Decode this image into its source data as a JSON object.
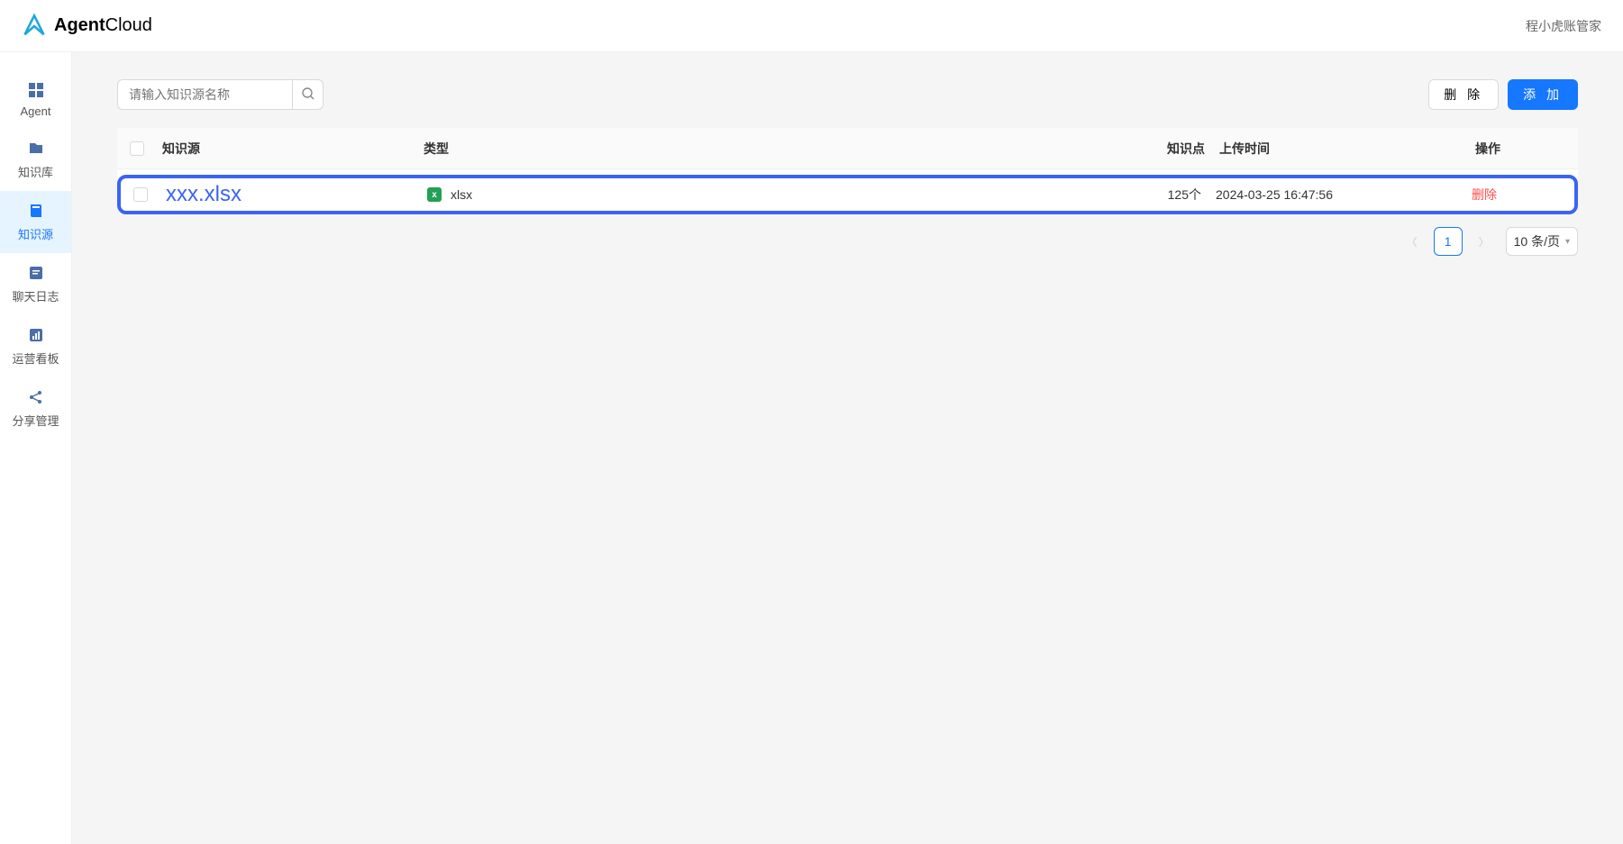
{
  "header": {
    "logo_bold": "Agent",
    "logo_light": "Cloud",
    "user_name": "程小虎账管家"
  },
  "sidebar": {
    "items": [
      {
        "label": "Agent",
        "icon": "grid-icon"
      },
      {
        "label": "知识库",
        "icon": "folder-icon"
      },
      {
        "label": "知识源",
        "icon": "book-icon",
        "active": true
      },
      {
        "label": "聊天日志",
        "icon": "chat-log-icon"
      },
      {
        "label": "运营看板",
        "icon": "dashboard-icon"
      },
      {
        "label": "分享管理",
        "icon": "share-icon"
      }
    ]
  },
  "toolbar": {
    "search_placeholder": "请输入知识源名称",
    "delete_label": "删 除",
    "add_label": "添 加"
  },
  "table": {
    "headers": {
      "name": "知识源",
      "type": "类型",
      "points": "知识点",
      "upload_time": "上传时间",
      "action": "操作"
    },
    "rows": [
      {
        "name": "xxx.xlsx",
        "type": "xlsx",
        "points": "125个",
        "upload_time": "2024-03-25 16:47:56",
        "action": "删除"
      }
    ]
  },
  "pagination": {
    "current": "1",
    "page_size_label": "10 条/页"
  }
}
